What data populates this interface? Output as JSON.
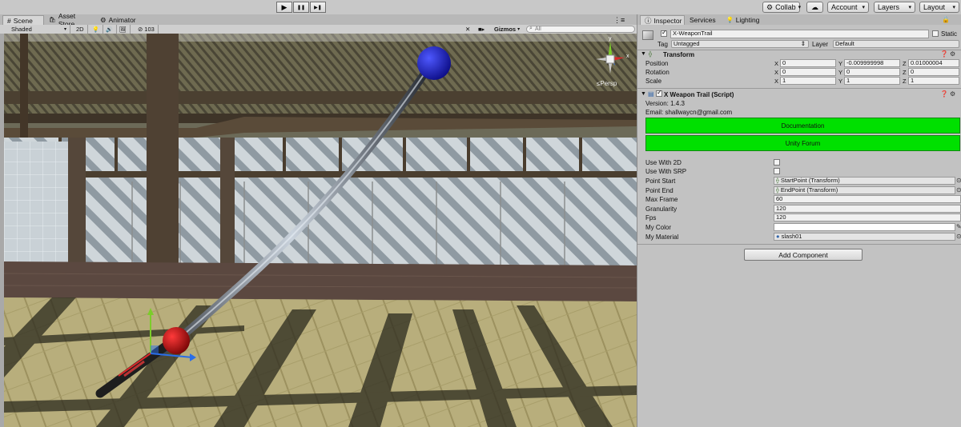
{
  "toolbar": {
    "play_icon": "▶",
    "pause_icon": "❚❚",
    "step_icon": "▶❚",
    "collab_label": "Collab",
    "cloud_icon": "☁",
    "account_label": "Account",
    "layers_label": "Layers",
    "layout_label": "Layout"
  },
  "tabs": [
    {
      "label": "Scene",
      "icon": "#"
    },
    {
      "label": "Asset Store",
      "icon": "🛍"
    },
    {
      "label": "Animator",
      "icon": "⚙"
    }
  ],
  "scene_toolbar": {
    "shading_mode": "Shaded",
    "mode_2d": "2D",
    "lighting_icon": "💡",
    "audio_icon": "🔊",
    "effects_icon": "🖼",
    "hidden_count": "103",
    "gizmos_label": "Gizmos",
    "search_placeholder": "All"
  },
  "scene": {
    "persp_label": "Persp"
  },
  "inspector": {
    "tabs": [
      {
        "label": "Inspector",
        "icon": "ⓘ"
      },
      {
        "label": "Services",
        "icon": ""
      },
      {
        "label": "Lighting",
        "icon": "💡"
      }
    ],
    "object_name": "X-WeaponTrail",
    "static_label": "Static",
    "tag_label": "Tag",
    "tag_value": "Untagged",
    "layer_label": "Layer",
    "layer_value": "Default",
    "transform": {
      "title": "Transform",
      "rows": [
        {
          "label": "Position",
          "x": "0",
          "y": "-0.009999998",
          "z": "0.01000004"
        },
        {
          "label": "Rotation",
          "x": "0",
          "y": "0",
          "z": "0"
        },
        {
          "label": "Scale",
          "x": "1",
          "y": "1",
          "z": "1"
        }
      ]
    },
    "script": {
      "title": "X Weapon Trail (Script)",
      "version": "Version: 1.4.3",
      "email": "Email: shallwaycn@gmail.com",
      "documentation_button": "Documentation",
      "forum_button": "Unity Forum",
      "fields": {
        "use_with_2d": "Use With 2D",
        "use_with_srp": "Use With SRP",
        "point_start": "Point Start",
        "point_start_value": "StartPoint (Transform)",
        "point_end": "Point End",
        "point_end_value": "EndPoint (Transform)",
        "max_frame": "Max Frame",
        "max_frame_value": "60",
        "granularity": "Granularity",
        "granularity_value": "120",
        "fps": "Fps",
        "fps_value": "120",
        "my_color": "My Color",
        "my_material": "My Material",
        "my_material_value": "slash01"
      }
    },
    "add_component_label": "Add Component"
  },
  "colors": {
    "green_button": "#00e000",
    "sphere_start": "#cc1111",
    "sphere_end": "#1a1ad8"
  }
}
